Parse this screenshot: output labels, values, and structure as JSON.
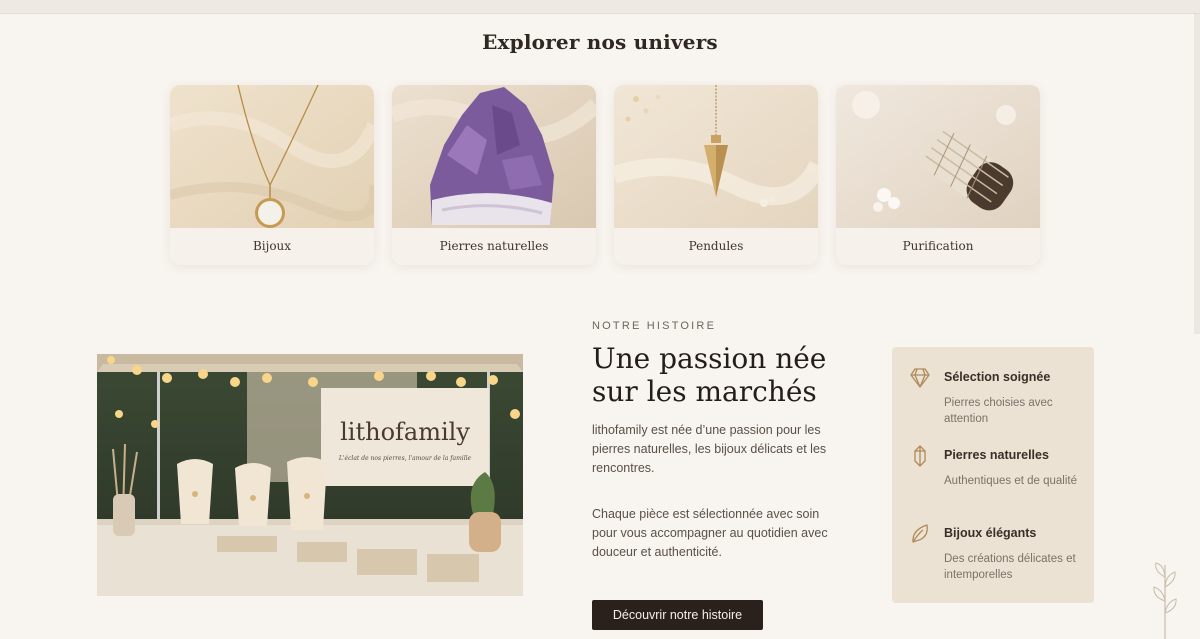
{
  "explore": {
    "title": "Explorer nos univers",
    "categories": [
      {
        "label": "Bijoux",
        "icon": "necklace-photo"
      },
      {
        "label": "Pierres naturelles",
        "icon": "amethyst-photo"
      },
      {
        "label": "Pendules",
        "icon": "pendulum-photo"
      },
      {
        "label": "Purification",
        "icon": "sage-bundle-photo"
      }
    ]
  },
  "story": {
    "eyebrow": "NOTRE HISTOIRE",
    "title": "Une passion née sur les marchés",
    "paragraph1": "lithofamily est née d’une passion pour les pierres naturelles, les bijoux délicats et les rencontres.",
    "paragraph2": "Chaque pièce est sélectionnée avec soin pour vous accompagner au quotidien avec douceur et authenticité.",
    "button_label": "Découvrir notre histoire",
    "photo": {
      "banner_text": "lithofamily",
      "banner_tagline": "L'éclat de nos pierres, l'amour de la famille"
    }
  },
  "features": [
    {
      "icon": "diamond-icon",
      "title": "Sélection soignée",
      "description": "Pierres choisies avec attention"
    },
    {
      "icon": "crystal-icon",
      "title": "Pierres naturelles",
      "description": "Authentiques et de qualité"
    },
    {
      "icon": "leaf-icon",
      "title": "Bijoux élégants",
      "description": "Des créations délicates et intemporelles"
    }
  ],
  "colors": {
    "background": "#f8f4ef",
    "button": "#2a211c",
    "feature_panel": "#ece2d4",
    "accent_gold": "#b08a5a"
  }
}
